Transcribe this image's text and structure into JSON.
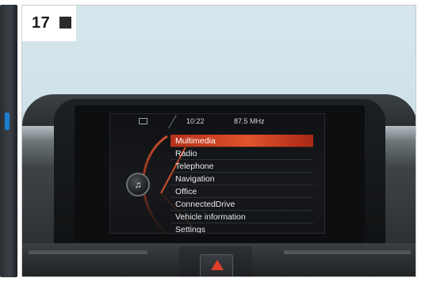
{
  "figure": {
    "number": "17"
  },
  "screen": {
    "status": {
      "time": "10:22",
      "frequency": "87.5 MHz"
    },
    "menu": {
      "selected": "Multimedia",
      "items": [
        {
          "label": "Multimedia"
        },
        {
          "label": "Radio"
        },
        {
          "label": "Telephone"
        },
        {
          "label": "Navigation"
        },
        {
          "label": "Office"
        },
        {
          "label": "ConnectedDrive"
        },
        {
          "label": "Vehicle information"
        },
        {
          "label": "Settings"
        }
      ]
    },
    "icons": {
      "status": "screen-mode-icon",
      "media": "music-note-icon",
      "hazard": "hazard-warning-icon"
    },
    "colors": {
      "highlight": "#d9482a",
      "screen_bg": "#121417",
      "text": "#e9ebec"
    }
  }
}
